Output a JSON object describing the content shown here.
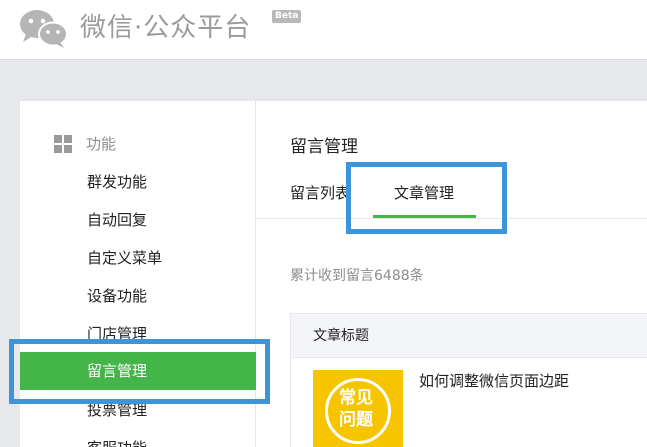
{
  "header": {
    "brand": "微信·公众平台",
    "beta": "Beta"
  },
  "sidebar": {
    "section_label": "功能",
    "items": [
      {
        "label": "群发功能",
        "active": false
      },
      {
        "label": "自动回复",
        "active": false
      },
      {
        "label": "自定义菜单",
        "active": false
      },
      {
        "label": "设备功能",
        "active": false
      },
      {
        "label": "门店管理",
        "active": false
      },
      {
        "label": "留言管理",
        "active": true
      },
      {
        "label": "投票管理",
        "active": false
      },
      {
        "label": "客服功能",
        "active": false
      }
    ]
  },
  "main": {
    "title": "留言管理",
    "tabs": [
      {
        "label": "留言列表",
        "active": false
      },
      {
        "label": "文章管理",
        "active": true
      }
    ],
    "summary": "累计收到留言6488条",
    "table": {
      "column": "文章标题",
      "rows": [
        {
          "thumb_line1": "常见",
          "thumb_line2": "问题",
          "title": "如何调整微信页面边距"
        }
      ]
    }
  },
  "colors": {
    "accent": "#44b549",
    "highlight": "#3d95d8",
    "thumb": "#f7c400"
  }
}
